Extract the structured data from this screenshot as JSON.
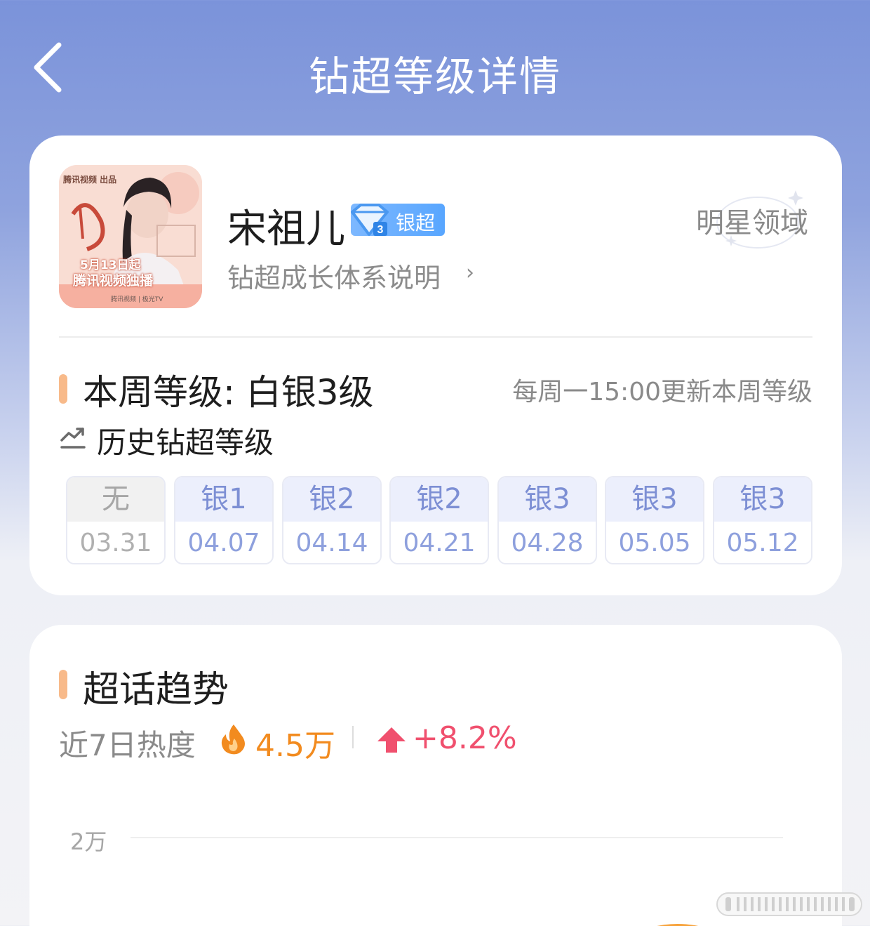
{
  "header": {
    "title": "钻超等级详情"
  },
  "profile": {
    "name": "宋祖儿",
    "badge_label": "银超",
    "growth_link": "钻超成长体系说明",
    "domain": "明星领域",
    "poster": {
      "logo": "腾讯视频 出品",
      "date": "5月13日起",
      "subtitle": "腾讯视频独播",
      "brand": "腾讯视频 | 极光TV"
    }
  },
  "level": {
    "week_level": "本周等级: 白银3级",
    "update_note": "每周一15:00更新本周等级",
    "history_label": "历史钻超等级",
    "history": [
      {
        "level": "无",
        "date": "03.31"
      },
      {
        "level": "银1",
        "date": "04.07"
      },
      {
        "level": "银2",
        "date": "04.14"
      },
      {
        "level": "银2",
        "date": "04.21"
      },
      {
        "level": "银3",
        "date": "04.28"
      },
      {
        "level": "银3",
        "date": "05.05"
      },
      {
        "level": "银3",
        "date": "05.12"
      }
    ]
  },
  "trend": {
    "title": "超话趋势",
    "heat_label": "近7日热度",
    "heat_value": "4.5万",
    "change": "+8.2%",
    "y_tick": "2万"
  },
  "colors": {
    "accent_bar": "#f8ba8a",
    "level_text": "#7d8fd4",
    "heat": "#f28b1f",
    "change_up": "#f0506e",
    "badge": "#58a6ff"
  },
  "icons": {
    "back": "chevron-left-icon",
    "badge": "diamond-icon",
    "history": "trend-chart-icon",
    "heat": "fire-icon",
    "change": "arrow-up-icon"
  }
}
